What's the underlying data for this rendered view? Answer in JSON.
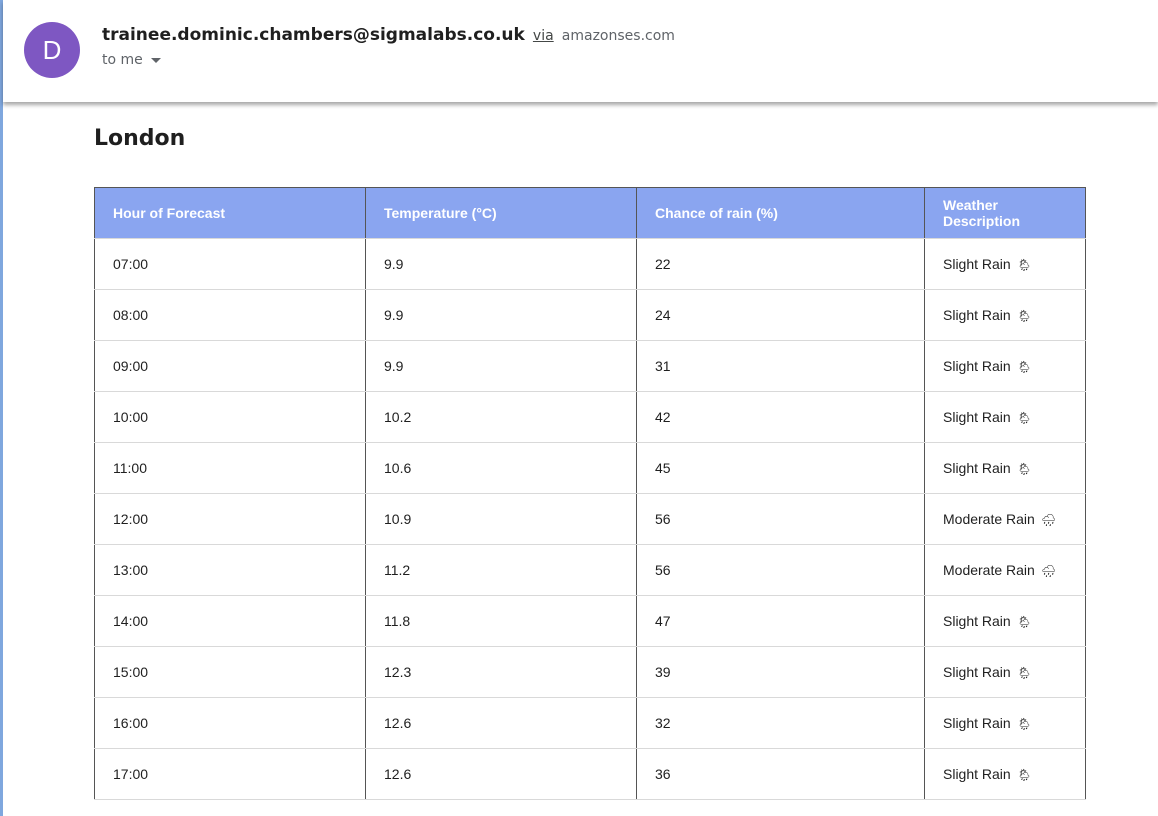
{
  "header": {
    "avatar_letter": "D",
    "avatar_color": "#7e57c2",
    "sender_email": "trainee.dominic.chambers@sigmalabs.co.uk",
    "via_label": "via",
    "via_domain": "amazonses.com",
    "recipient_label": "to me"
  },
  "body": {
    "city": "London",
    "table": {
      "header_color": "#8aa5f0",
      "columns": [
        "Hour of Forecast",
        "Temperature (°C)",
        "Chance of rain (%)",
        "Weather Description"
      ],
      "rows": [
        {
          "hour": "07:00",
          "temp": "9.9",
          "rain": "22",
          "desc": "Slight Rain",
          "icon": "sun-behind-rain-cloud-icon"
        },
        {
          "hour": "08:00",
          "temp": "9.9",
          "rain": "24",
          "desc": "Slight Rain",
          "icon": "sun-behind-rain-cloud-icon"
        },
        {
          "hour": "09:00",
          "temp": "9.9",
          "rain": "31",
          "desc": "Slight Rain",
          "icon": "sun-behind-rain-cloud-icon"
        },
        {
          "hour": "10:00",
          "temp": "10.2",
          "rain": "42",
          "desc": "Slight Rain",
          "icon": "sun-behind-rain-cloud-icon"
        },
        {
          "hour": "11:00",
          "temp": "10.6",
          "rain": "45",
          "desc": "Slight Rain",
          "icon": "sun-behind-rain-cloud-icon"
        },
        {
          "hour": "12:00",
          "temp": "10.9",
          "rain": "56",
          "desc": "Moderate Rain",
          "icon": "rain-cloud-icon"
        },
        {
          "hour": "13:00",
          "temp": "11.2",
          "rain": "56",
          "desc": "Moderate Rain",
          "icon": "rain-cloud-icon"
        },
        {
          "hour": "14:00",
          "temp": "11.8",
          "rain": "47",
          "desc": "Slight Rain",
          "icon": "sun-behind-rain-cloud-icon"
        },
        {
          "hour": "15:00",
          "temp": "12.3",
          "rain": "39",
          "desc": "Slight Rain",
          "icon": "sun-behind-rain-cloud-icon"
        },
        {
          "hour": "16:00",
          "temp": "12.6",
          "rain": "32",
          "desc": "Slight Rain",
          "icon": "sun-behind-rain-cloud-icon"
        },
        {
          "hour": "17:00",
          "temp": "12.6",
          "rain": "36",
          "desc": "Slight Rain",
          "icon": "sun-behind-rain-cloud-icon"
        }
      ]
    }
  }
}
